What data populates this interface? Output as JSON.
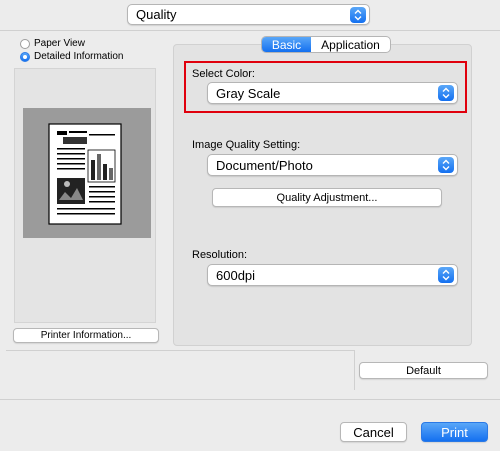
{
  "top_menu": {
    "selected": "Quality"
  },
  "view_options": {
    "paper_view": "Paper View",
    "detailed_information": "Detailed Information",
    "selected": "Detailed Information"
  },
  "printer_info_button": "Printer Information...",
  "tabs": {
    "basic": "Basic",
    "application": "Application",
    "active": "Basic"
  },
  "select_color": {
    "label": "Select Color:",
    "value": "Gray Scale"
  },
  "image_quality": {
    "label": "Image Quality Setting:",
    "value": "Document/Photo"
  },
  "quality_adjustment_button": "Quality Adjustment...",
  "resolution": {
    "label": "Resolution:",
    "value": "600dpi"
  },
  "default_button": "Default",
  "cancel_button": "Cancel",
  "print_button": "Print",
  "colors": {
    "accent": "#1a78f2",
    "highlight_border": "#e0000d"
  }
}
